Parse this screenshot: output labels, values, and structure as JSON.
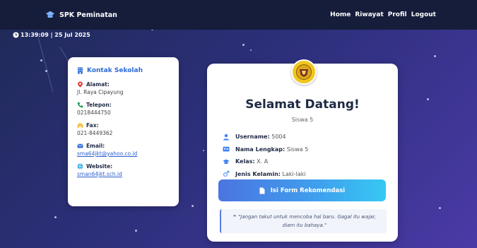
{
  "navbar": {
    "brand": "SPK Peminatan",
    "links": [
      "Home",
      "Riwayat",
      "Profil",
      "Logout"
    ]
  },
  "clock": {
    "text": "13:39:09 | 25 Jul 2025"
  },
  "contact": {
    "title": "Kontak Sekolah",
    "items": [
      {
        "label": "Alamat:",
        "value": "Jl. Raya Cipayung",
        "icon": "location-icon",
        "color": "#e23d3d"
      },
      {
        "label": "Telepon:",
        "value": "0218444750",
        "icon": "phone-icon",
        "color": "#1f9d55"
      },
      {
        "label": "Fax:",
        "value": "021-8449362",
        "icon": "fax-icon",
        "color": "#f1b32a"
      },
      {
        "label": "Email:",
        "value": "sma64jkt@yahoo.co.id",
        "icon": "email-icon",
        "color": "#2b6ad6"
      },
      {
        "label": "Website:",
        "value": "sman64jkt.sch.id",
        "icon": "globe-icon",
        "color": "#2aa6e0"
      }
    ]
  },
  "main": {
    "title": "Selamat Datang!",
    "role": "Siswa 5",
    "info": [
      {
        "label": "Username:",
        "value": "5004",
        "icon": "user-icon"
      },
      {
        "label": "Nama Lengkap:",
        "value": "Siswa 5",
        "icon": "id-card-icon"
      },
      {
        "label": "Kelas:",
        "value": "X. A",
        "icon": "graduation-cap-icon"
      },
      {
        "label": "Jenis Kelamin:",
        "value": "Laki-laki",
        "icon": "gender-icon"
      }
    ],
    "button_label": "Isi Form Rekomendasi",
    "quote": "\"Jangan takut untuk mencoba hal baru. Gagal itu wajar, diam itu bahaya.\""
  },
  "colors": {
    "navbar": "#161d3a",
    "accent": "#2b6ad6",
    "button_start": "#4b74e0",
    "button_end": "#36c9f3",
    "logo": "#f0c61e"
  }
}
